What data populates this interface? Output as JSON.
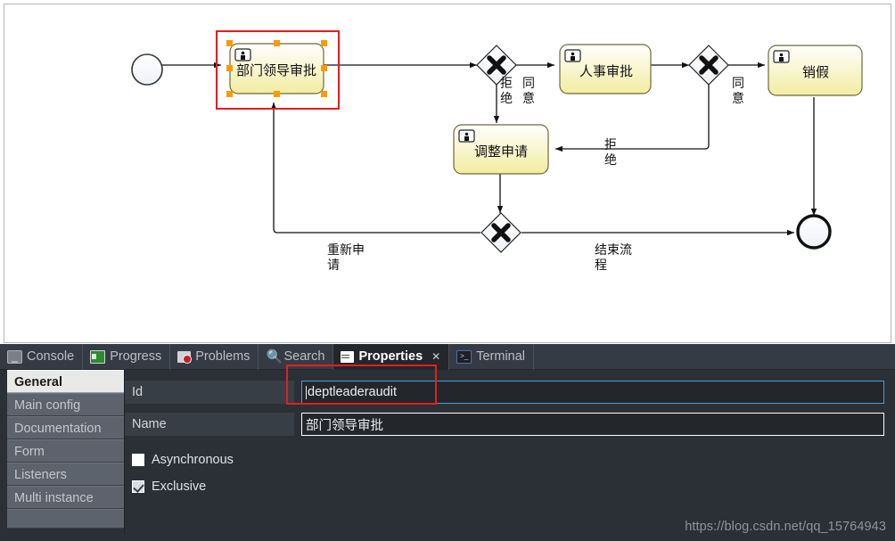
{
  "canvas": {
    "nodes": [
      {
        "id": "start",
        "type": "start-event",
        "label": ""
      },
      {
        "id": "deptleaderaudit",
        "type": "user-task",
        "label": "部门领导审批",
        "selected": true
      },
      {
        "id": "gw1",
        "type": "exclusive-gateway",
        "label": ""
      },
      {
        "id": "hraudit",
        "type": "user-task",
        "label": "人事审批"
      },
      {
        "id": "gw2",
        "type": "exclusive-gateway",
        "label": ""
      },
      {
        "id": "xiaojia",
        "type": "user-task",
        "label": "销假"
      },
      {
        "id": "modifyapply",
        "type": "user-task",
        "label": "调整申请"
      },
      {
        "id": "gw3",
        "type": "exclusive-gateway",
        "label": ""
      },
      {
        "id": "end",
        "type": "end-event",
        "label": ""
      }
    ],
    "edge_labels": {
      "agree1": "同意",
      "reject1": "拒绝",
      "agree2": "同意",
      "reject2": "拒绝",
      "reapply": "重新申请",
      "endflow": "结束流程"
    }
  },
  "tabs": [
    {
      "label": "Console",
      "icon": "console-icon",
      "active": false,
      "closable": false
    },
    {
      "label": "Progress",
      "icon": "progress-icon",
      "active": false,
      "closable": false
    },
    {
      "label": "Problems",
      "icon": "problems-icon",
      "active": false,
      "closable": false
    },
    {
      "label": "Search",
      "icon": "search-icon",
      "active": false,
      "closable": false
    },
    {
      "label": "Properties",
      "icon": "properties-icon",
      "active": true,
      "closable": true,
      "close_glyph": "✕"
    },
    {
      "label": "Terminal",
      "icon": "terminal-icon",
      "active": false,
      "closable": false
    }
  ],
  "properties": {
    "nav": [
      {
        "label": "General",
        "selected": true
      },
      {
        "label": "Main config",
        "selected": false
      },
      {
        "label": "Documentation",
        "selected": false
      },
      {
        "label": "Form",
        "selected": false
      },
      {
        "label": "Listeners",
        "selected": false
      },
      {
        "label": "Multi instance",
        "selected": false
      }
    ],
    "fields": [
      {
        "label": "Id",
        "value": "deptleaderaudit",
        "focused": true
      },
      {
        "label": "Name",
        "value": "部门领导审批",
        "focused": false
      }
    ],
    "checkboxes": [
      {
        "label": "Asynchronous",
        "checked": false
      },
      {
        "label": "Exclusive",
        "checked": true
      }
    ]
  },
  "watermark": "https://blog.csdn.net/qq_15764943",
  "colors": {
    "accent_red": "#e81d1d",
    "task_fill_top": "#ffffff",
    "task_fill_bottom": "#f5f0a9",
    "selection_handle": "#ff9900",
    "focus_border": "#4e9ad6"
  }
}
